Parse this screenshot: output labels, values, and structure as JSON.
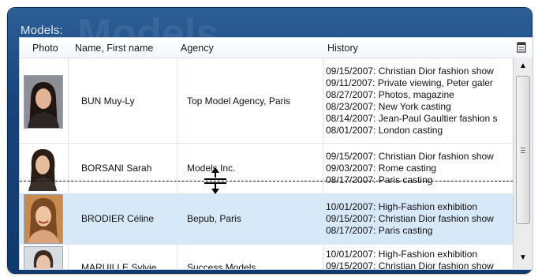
{
  "panel": {
    "title": "Models:",
    "watermark": "Models"
  },
  "columns": {
    "photo": "Photo",
    "name": "Name, First name",
    "agency": "Agency",
    "history": "History"
  },
  "rows": [
    {
      "name": "BUN Muy-Ly",
      "agency": "Top Model Agency, Paris",
      "history": [
        "09/15/2007: Christian Dior fashion show",
        "09/11/2007: Private viewing, Peter galer",
        "08/27/2007: Photos, magazine",
        "08/23/2007: New York casting",
        "08/14/2007: Jean-Paul Gaultier fashion s",
        "08/01/2007: London casting"
      ],
      "selected": false
    },
    {
      "name": "BORSANI Sarah",
      "agency": "Models Inc.",
      "history": [
        "09/15/2007: Christian Dior fashion show",
        "09/03/2007: Rome casting",
        "08/17/2007: Paris casting"
      ],
      "selected": false
    },
    {
      "name": "BRODIER Céline",
      "agency": "Bepub, Paris",
      "history": [
        "10/01/2007: High-Fashion exhibition",
        "09/15/2007: Christian Dior fashion show",
        "08/17/2007: Paris casting"
      ],
      "selected": true
    },
    {
      "name": "MARUILLE Sylvie",
      "agency": "Success Models",
      "history": [
        "10/01/2007: High-Fashion exhibition",
        "09/15/2007: Christian Dior fashion show"
      ],
      "selected": false
    }
  ],
  "icons": {
    "scroll_up": "triangle-up-icon",
    "scroll_down": "triangle-down-icon",
    "table_menu": "table-menu-icon",
    "row_resize": "row-resize-cursor-icon"
  },
  "colors": {
    "frame_blue": "#17457c",
    "selected_row": "#d7e8f8"
  }
}
